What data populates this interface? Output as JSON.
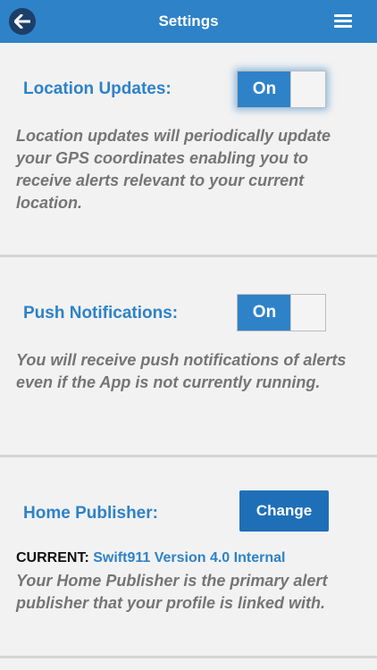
{
  "header": {
    "title": "Settings",
    "back_icon": "arrow-left-icon",
    "menu_icon": "hamburger-menu-icon"
  },
  "location": {
    "title": "Location Updates:",
    "toggle_label": "On",
    "description": "Location updates will periodically update your GPS coordinates enabling you to receive alerts relevant to your current location."
  },
  "push": {
    "title": "Push Notifications:",
    "toggle_label": "On",
    "description": "You will receive push notifications of alerts even if the App is not currently running."
  },
  "home_publisher": {
    "title": "Home Publisher:",
    "button_label": "Change",
    "current_label": "CURRENT:",
    "current_value": "Swift911 Version 4.0 Internal",
    "description": "Your Home Publisher is the primary alert publisher that your profile is linked with."
  },
  "colors": {
    "accent": "#2e82c8",
    "header_bg": "#2e82c8",
    "button_bg": "#1f6fb8",
    "description_text": "#757575",
    "page_bg": "#f2f2f2"
  }
}
